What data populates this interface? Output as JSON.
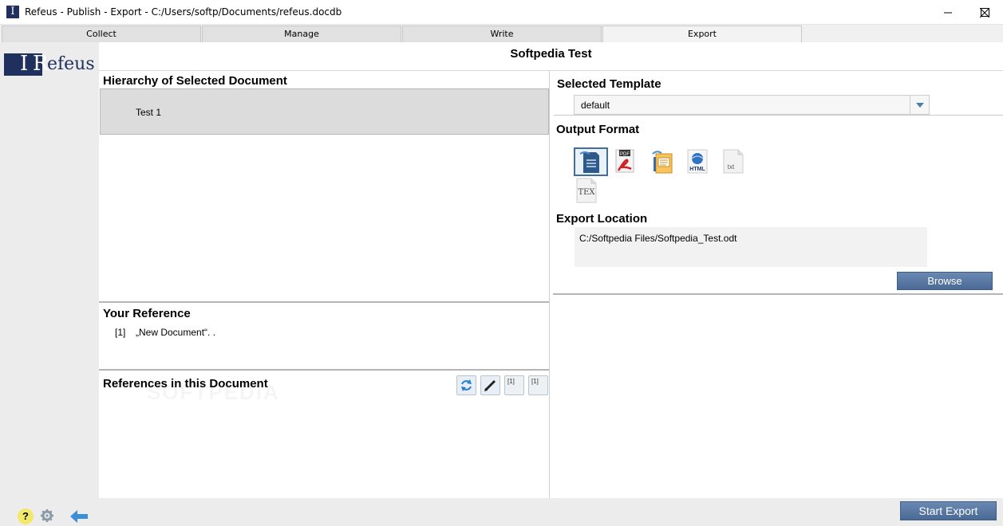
{
  "window": {
    "app_icon_letter": "I",
    "title": "Refeus - Publish - Export - C:/Users/softp/Documents/refeus.docdb"
  },
  "tabs": [
    {
      "label": "Collect"
    },
    {
      "label": "Manage"
    },
    {
      "label": "Write"
    },
    {
      "label": "Export",
      "active": true
    }
  ],
  "sidebar": {
    "logo": {
      "mark": "I",
      "letter": "R",
      "rest": "efeus"
    },
    "help_label": "?"
  },
  "document": {
    "title": "Softpedia Test"
  },
  "hierarchy": {
    "heading": "Hierarchy of Selected Document",
    "items": [
      "Test 1"
    ]
  },
  "your_reference": {
    "heading": "Your Reference",
    "number": "[1]",
    "text": "„New Document“. ."
  },
  "references_in_document": {
    "heading": "References in this Document",
    "toolbar_labels": {
      "insert": "[1]",
      "insert_alt": "[1]"
    }
  },
  "template": {
    "heading": "Selected Template",
    "selected": "default"
  },
  "output_format": {
    "heading": "Output Format",
    "formats": [
      {
        "name": "odt-icon",
        "selected": true
      },
      {
        "name": "pdf-icon",
        "label": "PDF"
      },
      {
        "name": "presentation-icon"
      },
      {
        "name": "html-icon",
        "label": "HTML"
      },
      {
        "name": "txt-icon",
        "label": "txt"
      },
      {
        "name": "tex-icon",
        "label": "TEX"
      }
    ]
  },
  "export_location": {
    "heading": "Export Location",
    "path": "C:/Softpedia Files/Softpedia_Test.odt",
    "browse_label": "Browse"
  },
  "footer": {
    "start_export_label": "Start Export"
  },
  "colors": {
    "brand_navy": "#1f2f5e",
    "button_blue": "#5677a3",
    "help_yellow": "#f2e86a",
    "back_arrow": "#3a8fd6"
  }
}
